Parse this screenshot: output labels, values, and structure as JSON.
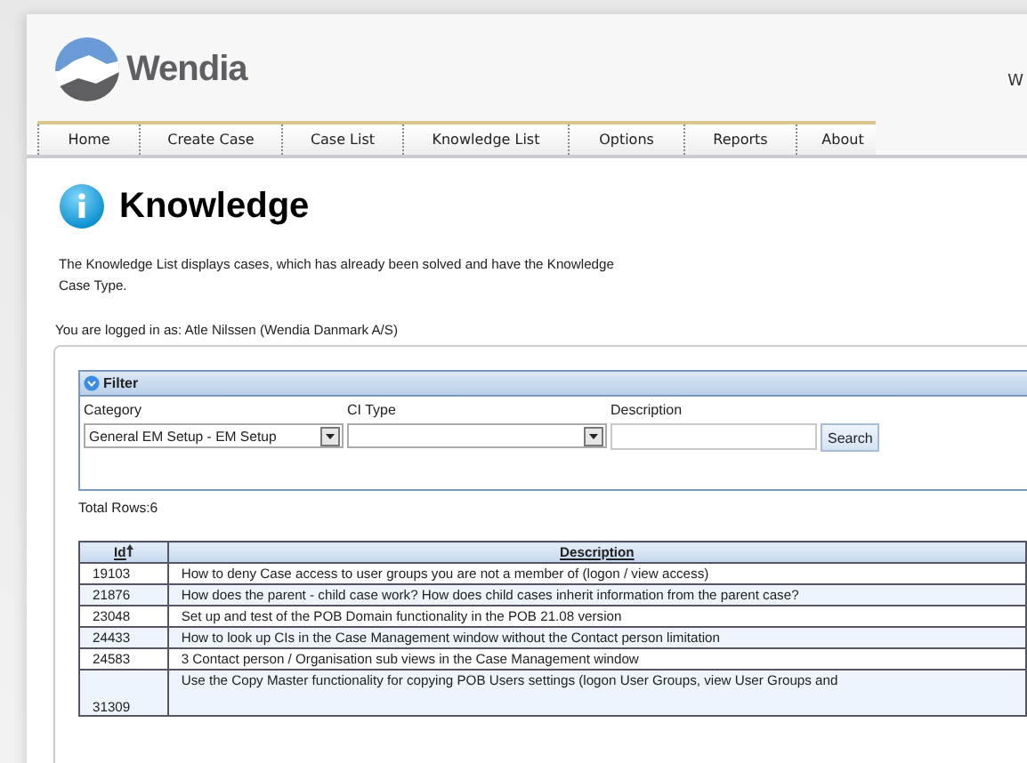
{
  "header": {
    "logo_text": "Wendia",
    "right_text": "W"
  },
  "nav": [
    {
      "label": "Home"
    },
    {
      "label": "Create Case"
    },
    {
      "label": "Case List"
    },
    {
      "label": "Knowledge List"
    },
    {
      "label": "Options"
    },
    {
      "label": "Reports"
    },
    {
      "label": "About"
    }
  ],
  "page": {
    "title": "Knowledge",
    "intro": "The Knowledge List displays cases, which has already been solved and have the Knowledge Case Type.",
    "logged_in": "You are logged in as: Atle Nilssen (Wendia Danmark A/S)"
  },
  "filter": {
    "title": "Filter",
    "category_label": "Category",
    "category_value": "General EM Setup - EM Setup",
    "ci_type_label": "CI Type",
    "description_label": "Description",
    "search_button": "Search"
  },
  "total_rows": "Total Rows:6",
  "table": {
    "columns": [
      "Id",
      "Description"
    ],
    "rows": [
      {
        "id": "19103",
        "description": "How to deny Case access to user groups you are not a member of (logon / view access)"
      },
      {
        "id": "21876",
        "description": "How does the parent - child case work? How does child cases inherit information from the parent case?"
      },
      {
        "id": "23048",
        "description": "Set up and test of the POB Domain functionality in the POB 21.08 version"
      },
      {
        "id": "24433",
        "description": "How to look up CIs in the Case Management window without the Contact person limitation"
      },
      {
        "id": "24583",
        "description": "3 Contact person / Organisation sub views in the Case Management window"
      },
      {
        "id": "31309",
        "description": "Use the Copy Master functionality for copying POB Users settings (logon User Groups, view User Groups and"
      }
    ]
  }
}
